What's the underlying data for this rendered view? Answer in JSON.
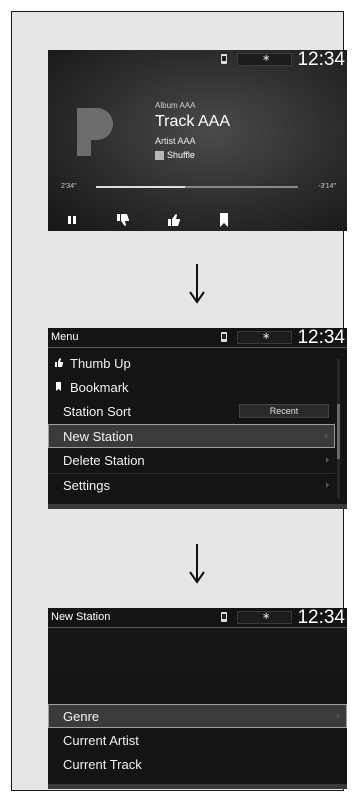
{
  "screen1": {
    "clock": "12:34",
    "album": "Album AAA",
    "track": "Track AAA",
    "artist": "Artist AAA",
    "shuffle_label": "Shuffle",
    "time_elapsed": "2'34\"",
    "time_remaining": "-3'14\"",
    "progress": 0.44,
    "controls": [
      "pause-icon",
      "thumb-down-icon",
      "thumb-up-icon",
      "bookmark-icon"
    ]
  },
  "screen2": {
    "title": "Menu",
    "clock": "12:34",
    "items": [
      {
        "label": "Thumb Up",
        "icon": "thumb-up-icon"
      },
      {
        "label": "Bookmark",
        "icon": "bookmark-icon"
      },
      {
        "label": "Station Sort",
        "value": "Recent"
      },
      {
        "label": "New Station",
        "selected": true
      },
      {
        "label": "Delete Station"
      },
      {
        "label": "Settings"
      }
    ]
  },
  "screen3": {
    "title": "New Station",
    "clock": "12:34",
    "items": [
      {
        "label": "Genre",
        "selected": true
      },
      {
        "label": "Current Artist"
      },
      {
        "label": "Current Track"
      }
    ]
  },
  "colors": {
    "screen_bg": "#141414",
    "text": "#ffffff",
    "selected_border": "#9c9c9c"
  }
}
